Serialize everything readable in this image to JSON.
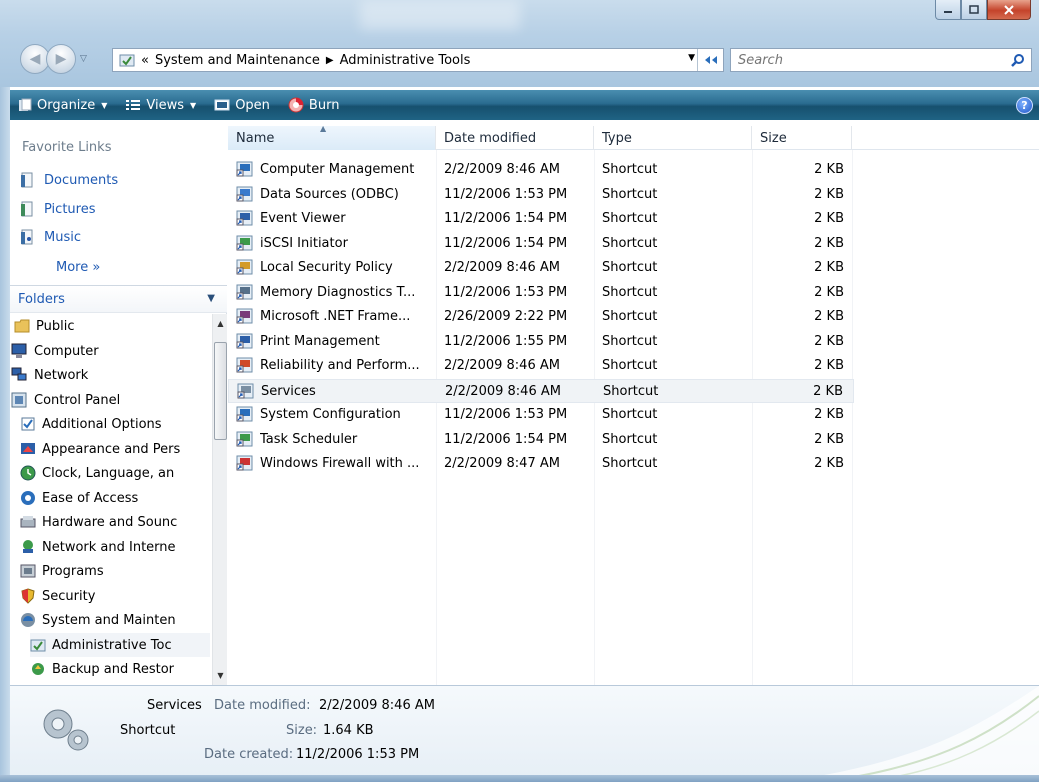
{
  "address": {
    "overflow": "«",
    "crumbs": [
      "System and Maintenance",
      "Administrative Tools"
    ],
    "search_placeholder": "Search"
  },
  "toolbar": {
    "organize": "Organize",
    "views": "Views",
    "open": "Open",
    "burn": "Burn",
    "help": "?"
  },
  "favorites": {
    "title": "Favorite Links",
    "items": [
      "Documents",
      "Pictures",
      "Music"
    ],
    "more": "More »"
  },
  "folders": {
    "title": "Folders",
    "items": [
      {
        "label": "Public",
        "icon": "folder-icon"
      },
      {
        "label": "Computer",
        "icon": "computer-icon"
      },
      {
        "label": "Network",
        "icon": "network-icon"
      },
      {
        "label": "Control Panel",
        "icon": "control-panel-icon"
      },
      {
        "label": "Additional Options",
        "icon": "checkbox-icon"
      },
      {
        "label": "Appearance and Pers",
        "icon": "appearance-icon"
      },
      {
        "label": "Clock, Language, an",
        "icon": "clock-icon"
      },
      {
        "label": "Ease of Access",
        "icon": "ease-of-access-icon"
      },
      {
        "label": "Hardware and Sounc",
        "icon": "hardware-icon"
      },
      {
        "label": "Network and Interne",
        "icon": "network-internet-icon"
      },
      {
        "label": "Programs",
        "icon": "programs-icon"
      },
      {
        "label": "Security",
        "icon": "shield-icon"
      },
      {
        "label": "System and Mainten",
        "icon": "system-icon"
      },
      {
        "label": "Administrative Toc",
        "icon": "admin-tools-icon"
      },
      {
        "label": "Backup and Restor",
        "icon": "backup-icon"
      }
    ]
  },
  "columns": {
    "name": "Name",
    "date": "Date modified",
    "type": "Type",
    "size": "Size"
  },
  "files": [
    {
      "name": "Computer Management",
      "date": "2/2/2009 8:46 AM",
      "type": "Shortcut",
      "size": "2 KB"
    },
    {
      "name": "Data Sources (ODBC)",
      "date": "11/2/2006 1:53 PM",
      "type": "Shortcut",
      "size": "2 KB"
    },
    {
      "name": "Event Viewer",
      "date": "11/2/2006 1:54 PM",
      "type": "Shortcut",
      "size": "2 KB"
    },
    {
      "name": "iSCSI Initiator",
      "date": "11/2/2006 1:54 PM",
      "type": "Shortcut",
      "size": "2 KB"
    },
    {
      "name": "Local Security Policy",
      "date": "2/2/2009 8:46 AM",
      "type": "Shortcut",
      "size": "2 KB"
    },
    {
      "name": "Memory Diagnostics T...",
      "date": "11/2/2006 1:53 PM",
      "type": "Shortcut",
      "size": "2 KB"
    },
    {
      "name": "Microsoft .NET Frame...",
      "date": "2/26/2009 2:22 PM",
      "type": "Shortcut",
      "size": "2 KB"
    },
    {
      "name": "Print Management",
      "date": "11/2/2006 1:55 PM",
      "type": "Shortcut",
      "size": "2 KB"
    },
    {
      "name": "Reliability and Perform...",
      "date": "2/2/2009 8:46 AM",
      "type": "Shortcut",
      "size": "2 KB"
    },
    {
      "name": "Services",
      "date": "2/2/2009 8:46 AM",
      "type": "Shortcut",
      "size": "2 KB"
    },
    {
      "name": "System Configuration",
      "date": "11/2/2006 1:53 PM",
      "type": "Shortcut",
      "size": "2 KB"
    },
    {
      "name": "Task Scheduler",
      "date": "11/2/2006 1:54 PM",
      "type": "Shortcut",
      "size": "2 KB"
    },
    {
      "name": "Windows Firewall with ...",
      "date": "2/2/2009 8:47 AM",
      "type": "Shortcut",
      "size": "2 KB"
    }
  ],
  "details": {
    "name": "Services",
    "type": "Shortcut",
    "modified_label": "Date modified:",
    "modified": "2/2/2009 8:46 AM",
    "size_label": "Size:",
    "size": "1.64 KB",
    "created_label": "Date created:",
    "created": "11/2/2006 1:53 PM"
  },
  "colors": {
    "toolbar": "#1f6384",
    "link": "#1f5ab3",
    "selection": "#f0f3f6"
  }
}
